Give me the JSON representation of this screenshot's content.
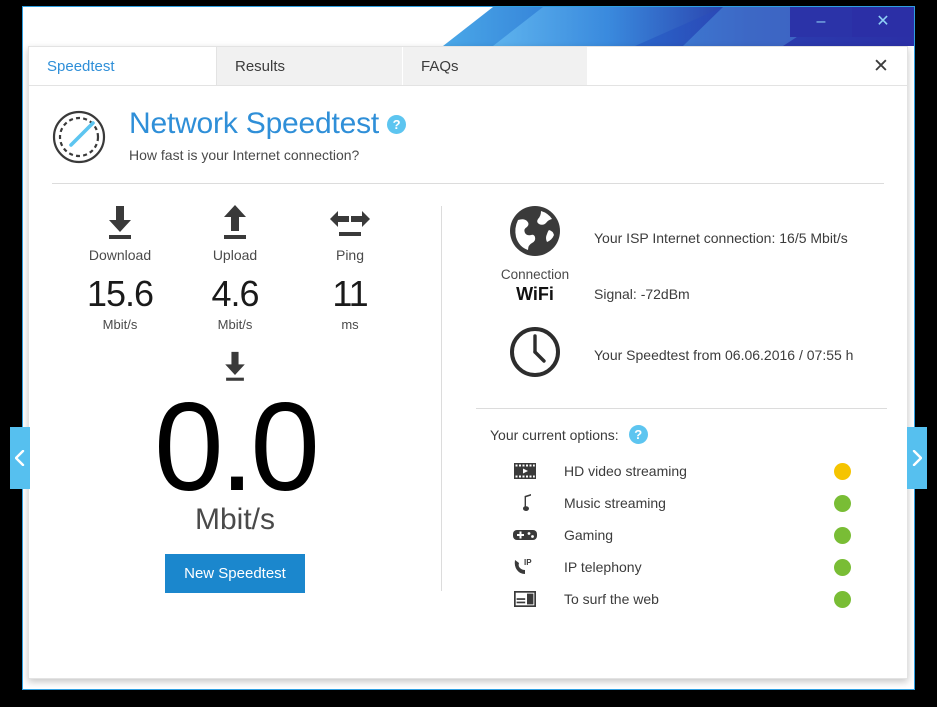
{
  "window": {
    "minimize_label": "–",
    "close_label": "✕",
    "card_close_label": "✕"
  },
  "tabs": [
    {
      "label": "Speedtest",
      "active": true
    },
    {
      "label": "Results",
      "active": false
    },
    {
      "label": "FAQs",
      "active": false
    }
  ],
  "header": {
    "icon": "speedometer-gauge-icon",
    "title": "Network Speedtest",
    "help_badge": "?",
    "subtitle": "How fast is your Internet connection?"
  },
  "metrics": [
    {
      "icon": "download-arrow-icon",
      "label": "Download",
      "value": "15.6",
      "unit": "Mbit/s"
    },
    {
      "icon": "upload-arrow-icon",
      "label": "Upload",
      "value": "4.6",
      "unit": "Mbit/s"
    },
    {
      "icon": "ping-double-arrow-icon",
      "label": "Ping",
      "value": "11",
      "unit": "ms"
    }
  ],
  "live": {
    "icon": "download-arrow-icon",
    "value": "0.0",
    "unit": "Mbit/s",
    "button_label": "New Speedtest"
  },
  "connection": {
    "icon": "globe-icon",
    "caption": "Connection",
    "value": "WiFi",
    "isp_text": "Your ISP Internet connection: 16/5 Mbit/s",
    "signal_text": "Signal: -72dBm"
  },
  "timestamp": {
    "icon": "clock-icon",
    "text": "Your Speedtest from 06.06.2016 / 07:55 h"
  },
  "options": {
    "header_label": "Your current options:",
    "help_badge": "?",
    "items": [
      {
        "icon": "film-strip-icon",
        "label": "HD video streaming",
        "status_color": "#f5c400"
      },
      {
        "icon": "music-note-icon",
        "label": "Music streaming",
        "status_color": "#79bd35"
      },
      {
        "icon": "gamepad-icon",
        "label": "Gaming",
        "status_color": "#79bd35"
      },
      {
        "icon": "ip-phone-icon",
        "label": "IP telephony",
        "status_color": "#79bd35"
      },
      {
        "icon": "browser-window-icon",
        "label": "To surf the web",
        "status_color": "#79bd35"
      }
    ]
  },
  "side_nav": {
    "prev_icon": "chevron-left-icon",
    "next_icon": "chevron-right-icon"
  },
  "colors": {
    "accent_blue": "#2f8fd8",
    "button_blue": "#1b87cd",
    "badge_blue": "#5dc5f0",
    "side_tab_blue": "#56c0ef",
    "status_green": "#79bd35",
    "status_amber": "#f5c400"
  }
}
